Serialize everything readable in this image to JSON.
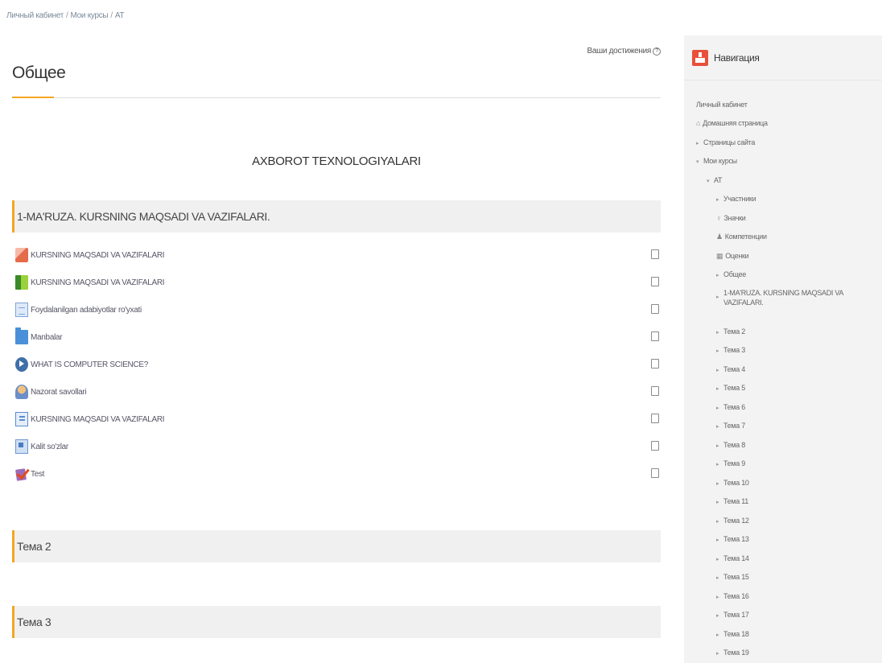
{
  "breadcrumb": {
    "items": [
      "Личный кабинет",
      "Мои курсы",
      "AT"
    ],
    "separator": "/"
  },
  "header": {
    "achievements_label": "Ваши достижения",
    "help_symbol": "?"
  },
  "page_title": "Общее",
  "course_heading": "AXBOROT TEXNOLOGIYALARI",
  "sections": [
    {
      "title": "1-MA'RUZA. KURSNING MAQSADI VA VAZIFALARI.",
      "activities": [
        {
          "name": "KURSNING MAQSADI VA VAZIFALARI",
          "icon": "presentation-icon"
        },
        {
          "name": "KURSNING MAQSADI VA VAZIFALARI",
          "icon": "book-icon"
        },
        {
          "name": "Foydalanilgan adabiyotlar ro'yxati",
          "icon": "document-icon"
        },
        {
          "name": "Manbalar",
          "icon": "folder-icon"
        },
        {
          "name": "WHAT IS COMPUTER SCIENCE?",
          "icon": "video-icon"
        },
        {
          "name": "Nazorat savollari",
          "icon": "question-icon"
        },
        {
          "name": "KURSNING MAQSADI VA VAZIFALARI",
          "icon": "documents-icon"
        },
        {
          "name": "Kalit so'zlar",
          "icon": "glossary-icon"
        },
        {
          "name": "Test",
          "icon": "quiz-icon"
        }
      ]
    },
    {
      "title": "Тема 2"
    },
    {
      "title": "Тема 3"
    }
  ],
  "sidebar": {
    "title": "Навигация",
    "items": [
      {
        "label": "Личный кабинет"
      },
      {
        "label": "Домашняя страница"
      },
      {
        "label": "Страницы сайта"
      },
      {
        "label": "Мои курсы"
      },
      {
        "label": "AT"
      },
      {
        "label": "Участники"
      },
      {
        "label": "Значки"
      },
      {
        "label": "Компетенции"
      },
      {
        "label": "Оценки"
      },
      {
        "label": "Общее"
      },
      {
        "label": "1-MA'RUZA. KURSNING MAQSADI VA VAZIFALARI."
      },
      {
        "label": "Тема 2"
      },
      {
        "label": "Тема 3"
      },
      {
        "label": "Тема 4"
      },
      {
        "label": "Тема 5"
      },
      {
        "label": "Тема 6"
      },
      {
        "label": "Тема 7"
      },
      {
        "label": "Тема 8"
      },
      {
        "label": "Тема 9"
      },
      {
        "label": "Тема 10"
      },
      {
        "label": "Тема 11"
      },
      {
        "label": "Тема 12"
      },
      {
        "label": "Тема 13"
      },
      {
        "label": "Тема 14"
      },
      {
        "label": "Тема 15"
      },
      {
        "label": "Тема 16"
      },
      {
        "label": "Тема 17"
      },
      {
        "label": "Тема 18"
      },
      {
        "label": "Тема 19"
      }
    ]
  },
  "colors": {
    "accent": "#f3a623",
    "nav_icon": "#e8503a",
    "section_bg": "#f0f0f0",
    "sidebar_bg": "#f3f3f3"
  }
}
